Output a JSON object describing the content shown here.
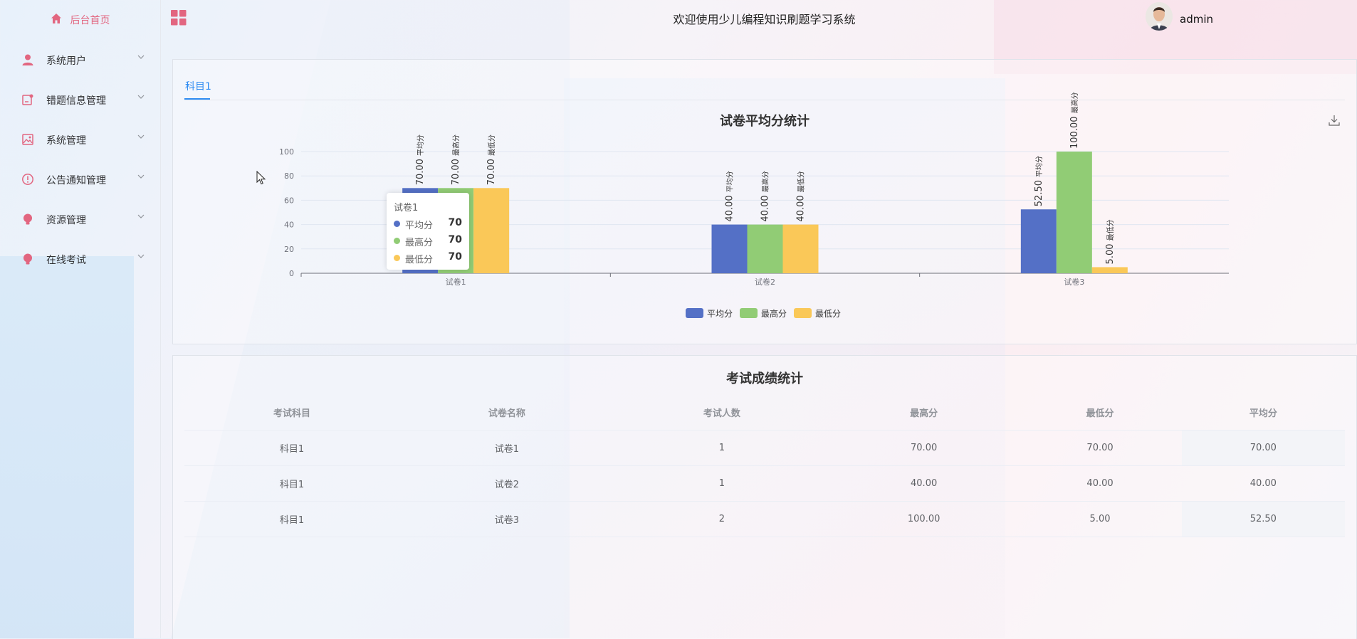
{
  "header": {
    "title": "欢迎使用少儿编程知识刷题学习系统",
    "username": "admin"
  },
  "sidebar": {
    "home": "后台首页",
    "items": [
      {
        "label": "系统用户",
        "icon": "user-icon"
      },
      {
        "label": "错题信息管理",
        "icon": "notebook-icon"
      },
      {
        "label": "系统管理",
        "icon": "picture-icon"
      },
      {
        "label": "公告通知管理",
        "icon": "warning-circle-icon"
      },
      {
        "label": "资源管理",
        "icon": "lightbulb-icon"
      },
      {
        "label": "在线考试",
        "icon": "lightbulb-icon"
      }
    ]
  },
  "colors": {
    "accent": "#e26680",
    "tab_active": "#2f8cf2",
    "series_avg": "#5470c6",
    "series_max": "#91cc75",
    "series_min": "#fac858"
  },
  "tabs": [
    {
      "label": "科目1"
    }
  ],
  "chart_data": {
    "type": "bar",
    "title": "试卷平均分统计",
    "categories": [
      "试卷1",
      "试卷2",
      "试卷3"
    ],
    "series": [
      {
        "name": "平均分",
        "values": [
          70,
          40,
          52.5
        ],
        "labels": [
          "70.00",
          "40.00",
          "52.50"
        ]
      },
      {
        "name": "最高分",
        "values": [
          70,
          40,
          100
        ],
        "labels": [
          "70.00",
          "40.00",
          "100.00"
        ]
      },
      {
        "name": "最低分",
        "values": [
          70,
          40,
          5
        ],
        "labels": [
          "70.00",
          "40.00",
          "5.00"
        ]
      }
    ],
    "y_ticks": [
      "0",
      "20",
      "40",
      "60",
      "80",
      "100"
    ],
    "ylim": [
      0,
      100
    ],
    "legend_position": "bottom-center",
    "grid": true
  },
  "tooltip": {
    "title": "试卷1",
    "rows": [
      {
        "name": "平均分",
        "value": "70"
      },
      {
        "name": "最高分",
        "value": "70"
      },
      {
        "name": "最低分",
        "value": "70"
      }
    ]
  },
  "table": {
    "title": "考试成绩统计",
    "headers": [
      "考试科目",
      "试卷名称",
      "考试人数",
      "最高分",
      "最低分",
      "平均分"
    ],
    "rows": [
      [
        "科目1",
        "试卷1",
        "1",
        "70.00",
        "70.00",
        "70.00"
      ],
      [
        "科目1",
        "试卷2",
        "1",
        "40.00",
        "40.00",
        "40.00"
      ],
      [
        "科目1",
        "试卷3",
        "2",
        "100.00",
        "5.00",
        "52.50"
      ]
    ]
  }
}
